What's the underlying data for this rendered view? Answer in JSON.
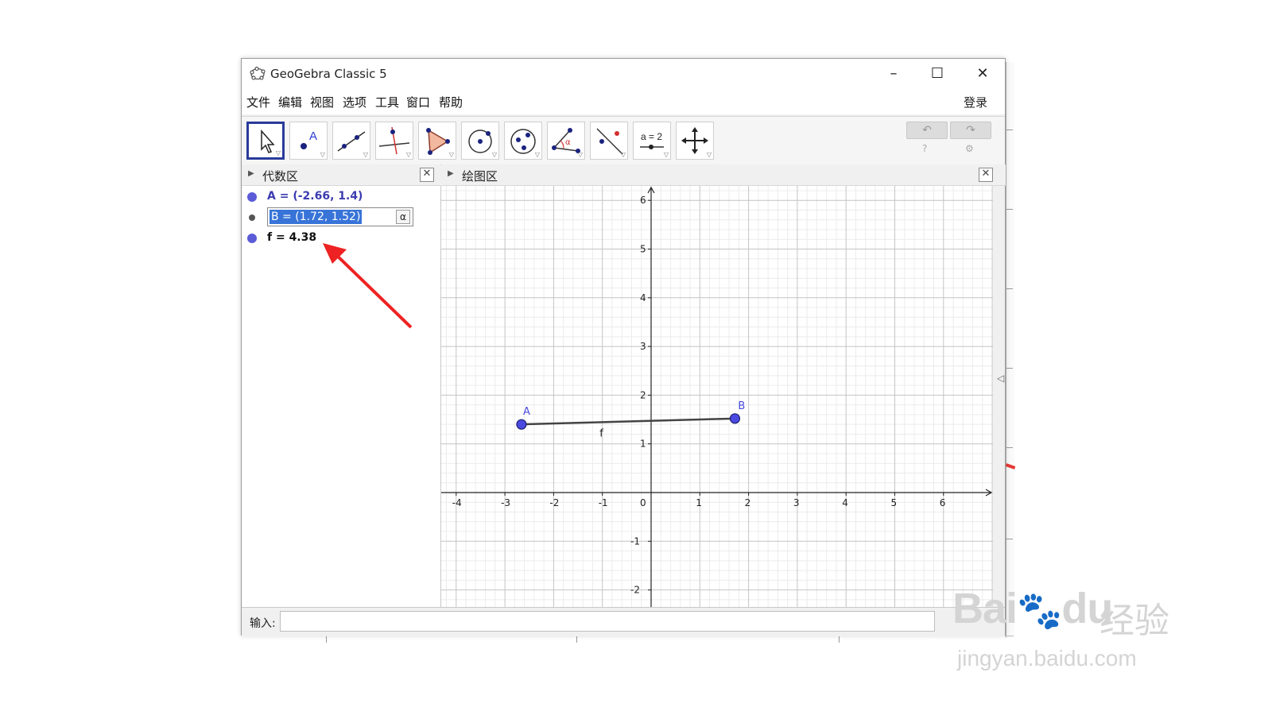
{
  "window": {
    "title": "GeoGebra Classic 5",
    "controls": {
      "minimize": "–",
      "maximize": "☐",
      "close": "✕"
    }
  },
  "menu": {
    "items": [
      "文件",
      "编辑",
      "视图",
      "选项",
      "工具",
      "窗口",
      "帮助"
    ],
    "login": "登录"
  },
  "toolbar": {
    "tools": [
      {
        "name": "move-tool-icon",
        "active": true
      },
      {
        "name": "point-tool-icon",
        "label": "A"
      },
      {
        "name": "line-tool-icon"
      },
      {
        "name": "perpendicular-line-tool-icon"
      },
      {
        "name": "polygon-tool-icon"
      },
      {
        "name": "circle-tool-icon"
      },
      {
        "name": "ellipse-tool-icon"
      },
      {
        "name": "angle-tool-icon",
        "label": "α"
      },
      {
        "name": "reflect-tool-icon"
      },
      {
        "name": "slider-tool-icon",
        "label": "a = 2"
      },
      {
        "name": "move-graphics-view-icon"
      }
    ],
    "undo_icon": "↶",
    "redo_icon": "↷",
    "help_icon": "?",
    "settings_icon": "⚙"
  },
  "algebra": {
    "title": "代数区",
    "rows": [
      {
        "text": "A = (-2.66, 1.4)",
        "color": "#3b3bb0"
      },
      {
        "text": "B = (1.72, 1.52)",
        "editing": true,
        "alpha_button": "α"
      },
      {
        "text": "f = 4.38",
        "color": "#111111"
      }
    ]
  },
  "graphics": {
    "title": "绘图区",
    "x_ticks": [
      "-4",
      "-3",
      "-2",
      "-1",
      "0",
      "1",
      "2",
      "3",
      "4",
      "5",
      "6"
    ],
    "y_ticks": [
      "6",
      "5",
      "4",
      "3",
      "2",
      "1",
      "-1",
      "-2"
    ],
    "point_A_label": "A",
    "point_B_label": "B",
    "segment_label": "f",
    "point_color": "#4a4ae0"
  },
  "input": {
    "label": "输入:",
    "value": ""
  },
  "watermark": {
    "logo": "Bai",
    "logo2": "du",
    "cn": "经验",
    "url": "jingyan.baidu.com"
  }
}
